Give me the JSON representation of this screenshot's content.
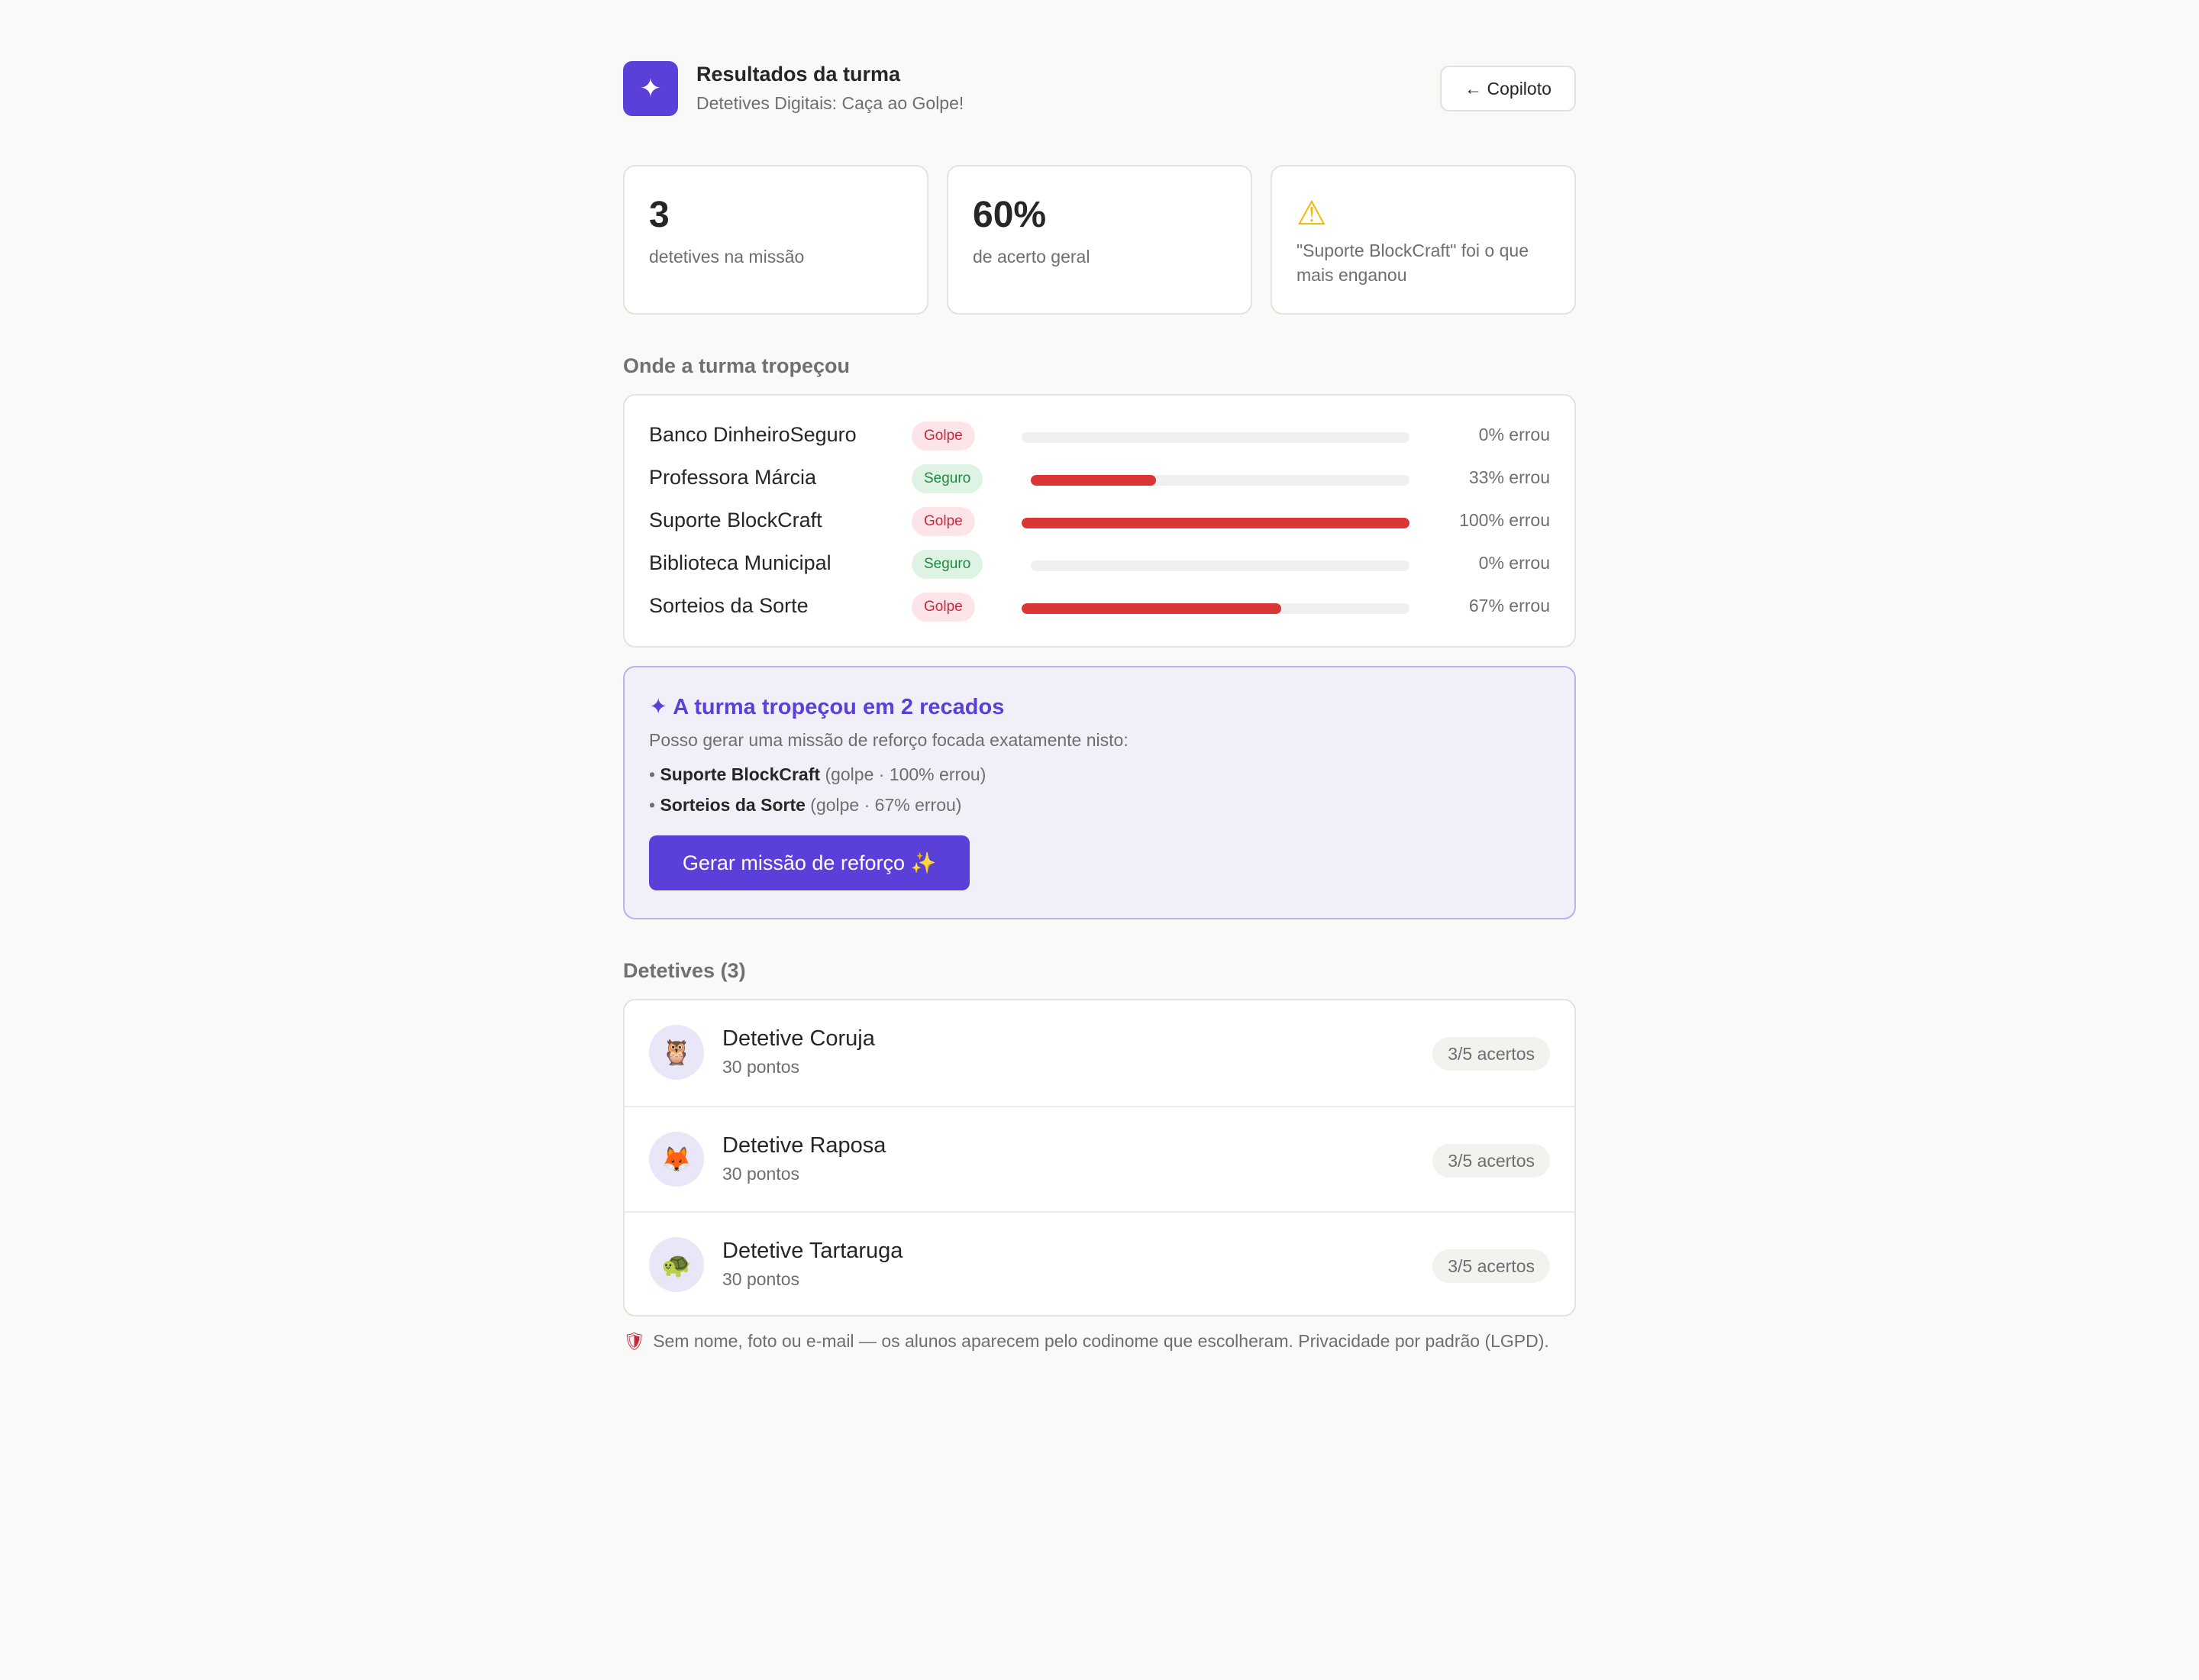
{
  "header": {
    "title": "Resultados da turma",
    "subtitle": "Detetives Digitais: Caça ao Golpe!",
    "back_label": "← Copiloto",
    "logo_icon": "✦"
  },
  "stats": [
    {
      "value": "3",
      "label": "detetives na missão"
    },
    {
      "value": "60%",
      "label": "de acerto geral"
    },
    {
      "icon": "⚠",
      "label": "\"Suporte BlockCraft\" foi o que mais enganou"
    }
  ],
  "stumble": {
    "title": "Onde a turma tropeçou",
    "rows": [
      {
        "name": "Banco DinheiroSeguro",
        "tag": "Golpe",
        "kind": "golpe",
        "error_fraction": 0,
        "pct_label": "0% errou"
      },
      {
        "name": "Professora Márcia",
        "tag": "Seguro",
        "kind": "seguro",
        "error_fraction": 0.33,
        "pct_label": "33% errou"
      },
      {
        "name": "Suporte BlockCraft",
        "tag": "Golpe",
        "kind": "golpe",
        "error_fraction": 1,
        "pct_label": "100% errou"
      },
      {
        "name": "Biblioteca Municipal",
        "tag": "Seguro",
        "kind": "seguro",
        "error_fraction": 0,
        "pct_label": "0% errou"
      },
      {
        "name": "Sorteios da Sorte",
        "tag": "Golpe",
        "kind": "golpe",
        "error_fraction": 0.67,
        "pct_label": "67% errou"
      }
    ]
  },
  "reinforce": {
    "title": "✦ A turma tropeçou em 2 recados",
    "description": "Posso gerar uma missão de reforço focada exatamente nisto:",
    "items": [
      {
        "name": "Suporte BlockCraft",
        "detail": "(golpe · 100% errou)"
      },
      {
        "name": "Sorteios da Sorte",
        "detail": "(golpe · 67% errou)"
      }
    ],
    "button_label": "Gerar missão de reforço ✨"
  },
  "detectives": {
    "title": "Detetives (3)",
    "items": [
      {
        "avatar": "🦉",
        "name": "Detetive Coruja",
        "points": "30 pontos",
        "score": "3/5 acertos"
      },
      {
        "avatar": "🦊",
        "name": "Detetive Raposa",
        "points": "30 pontos",
        "score": "3/5 acertos"
      },
      {
        "avatar": "🐢",
        "name": "Detetive Tartaruga",
        "points": "30 pontos",
        "score": "3/5 acertos"
      }
    ]
  },
  "privacy": {
    "icon": "🛡",
    "text": "Sem nome, foto ou e-mail — os alunos aparecem pelo codinome que escolheram. Privacidade por padrão (LGPD)."
  },
  "colors": {
    "accent": "#5a3fd8",
    "error_bar": "#dc3535",
    "golpe_bg": "#fde4e8",
    "seguro_bg": "#dff3e4"
  }
}
